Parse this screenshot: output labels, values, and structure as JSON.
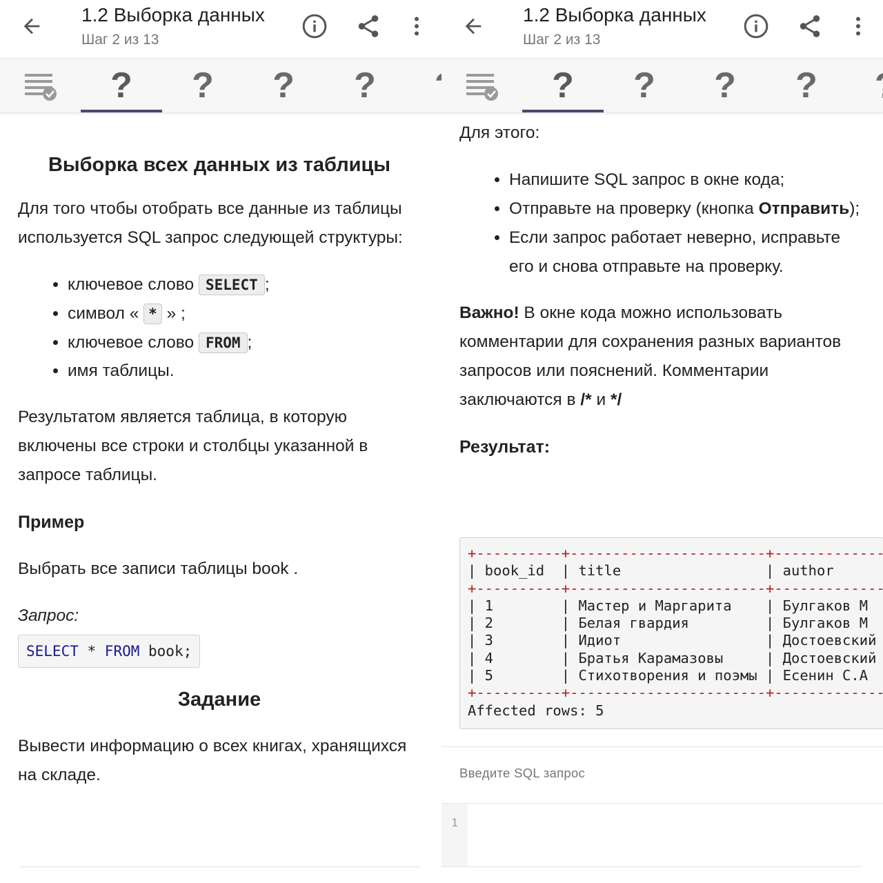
{
  "app": {
    "title": "1.2 Выборка данных",
    "subtitle": "Шаг 2 из 13",
    "accent": "#4a4a6e",
    "icons": [
      "arrow-back-icon",
      "info-icon",
      "share-icon",
      "more-vert-icon",
      "checklist-icon"
    ]
  },
  "steps": {
    "unknown_symbol": "?",
    "active_index": 1
  },
  "left": {
    "heading": "Выборка всех данных из таблицы",
    "intro": "Для того чтобы отобрать все данные из таблицы используется SQL запрос следующей структуры:",
    "list": {
      "kw_prefix": "ключевое слово",
      "select_code": "SELECT",
      "semi": ";",
      "symbol_prefix": "символ «",
      "star_code": "*",
      "symbol_suffix": "» ;",
      "from_code": "FROM",
      "table_name": "имя таблицы."
    },
    "result_text": "Результатом является таблица, в которую включены все строки и столбцы указанной в запросе таблицы.",
    "example_heading": "Пример",
    "example_text": "Выбрать все записи таблицы book .",
    "query_label": "Запрос:",
    "code": {
      "select": "SELECT",
      "star": " * ",
      "from": "FROM",
      "rest": " book;"
    },
    "task_heading": "Задание",
    "task_text": "Вывести информацию о всех книгах, хранящихся на складе."
  },
  "right": {
    "for_this": "Для этого:",
    "bullet1": "Напишите SQL запрос в окне кода;",
    "bullet2_before": "Отправьте на проверку (кнопка ",
    "bullet2_bold": "Отправить",
    "bullet2_after": ");",
    "bullet3": "Если запрос работает неверно, исправьте его и снова отправьте на проверку.",
    "important_bold": "Важно!",
    "important_text": " В окне кода можно использовать комментарии для сохранения разных вариантов запросов или пояснений. Комментарии заключаются в ",
    "comment_open": "/*",
    "and_word": " и ",
    "comment_close": "*/",
    "result_heading": "Результат:",
    "result_table": {
      "border": "+----------+-----------------------+-------------",
      "header": "| book_id  | title                 | author",
      "rows": [
        "| 1        | Мастер и Маргарита    | Булгаков М",
        "| 2        | Белая гвардия         | Булгаков М",
        "| 3        | Идиот                 | Достоевский",
        "| 4        | Братья Карамазовы     | Достоевский",
        "| 5        | Стихотворения и поэмы | Есенин С.А"
      ],
      "affected": "Affected rows: 5"
    },
    "sql_label": "Введите SQL запрос",
    "line_number": "1"
  }
}
